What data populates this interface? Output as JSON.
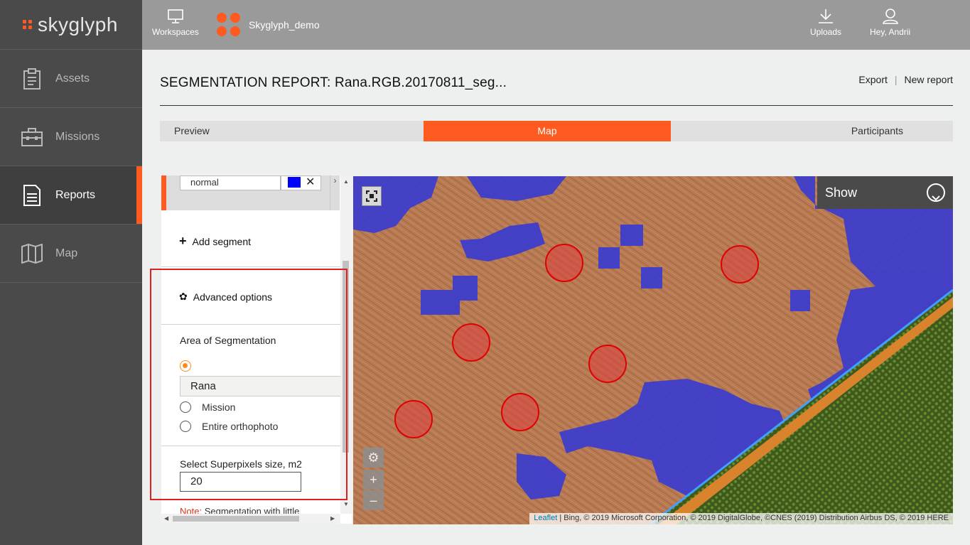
{
  "app": {
    "brand": "skyglyph",
    "accent": "#ff5a1f"
  },
  "sidebar": {
    "items": [
      {
        "label": "Assets",
        "icon": "clipboard-icon"
      },
      {
        "label": "Missions",
        "icon": "briefcase-icon"
      },
      {
        "label": "Reports",
        "icon": "document-icon",
        "active": true
      },
      {
        "label": "Map",
        "icon": "map-icon"
      }
    ]
  },
  "topbar": {
    "workspaces_label": "Workspaces",
    "workspace_name": "Skyglyph_demo",
    "uploads_label": "Uploads",
    "user_label": "Hey, Andrii"
  },
  "report": {
    "title": "SEGMENTATION REPORT: Rana.RGB.20170811_seg...",
    "export_label": "Export",
    "separator": "|",
    "new_report_label": "New report"
  },
  "tabs": [
    {
      "label": "Preview"
    },
    {
      "label": "Map",
      "active": true
    },
    {
      "label": "Participants"
    }
  ],
  "panel": {
    "segment_name": "normal",
    "segment_color": "#0000ff",
    "remove_symbol": "✕",
    "add_segment_label": "Add segment",
    "advanced_label": "Advanced options",
    "area_label": "Area of Segmentation",
    "area_field_value": "Rana",
    "options": [
      {
        "label": "Mission",
        "checked": false
      },
      {
        "label": "Entire orthophoto",
        "checked": false
      }
    ],
    "superpixels_label": "Select Superpixels size, m2",
    "superpixels_value": "20",
    "note_prefix": "Note:",
    "note_text": " Segmentation with little"
  },
  "map": {
    "show_label": "Show",
    "zoom_in": "+",
    "zoom_out": "–",
    "attribution_link": "Leaflet",
    "attribution_text": " | Bing, © 2019 Microsoft Corporation, © 2019 DigitalGlobe, ©CNES (2019) Distribution Airbus DS, © 2019 HERE"
  }
}
